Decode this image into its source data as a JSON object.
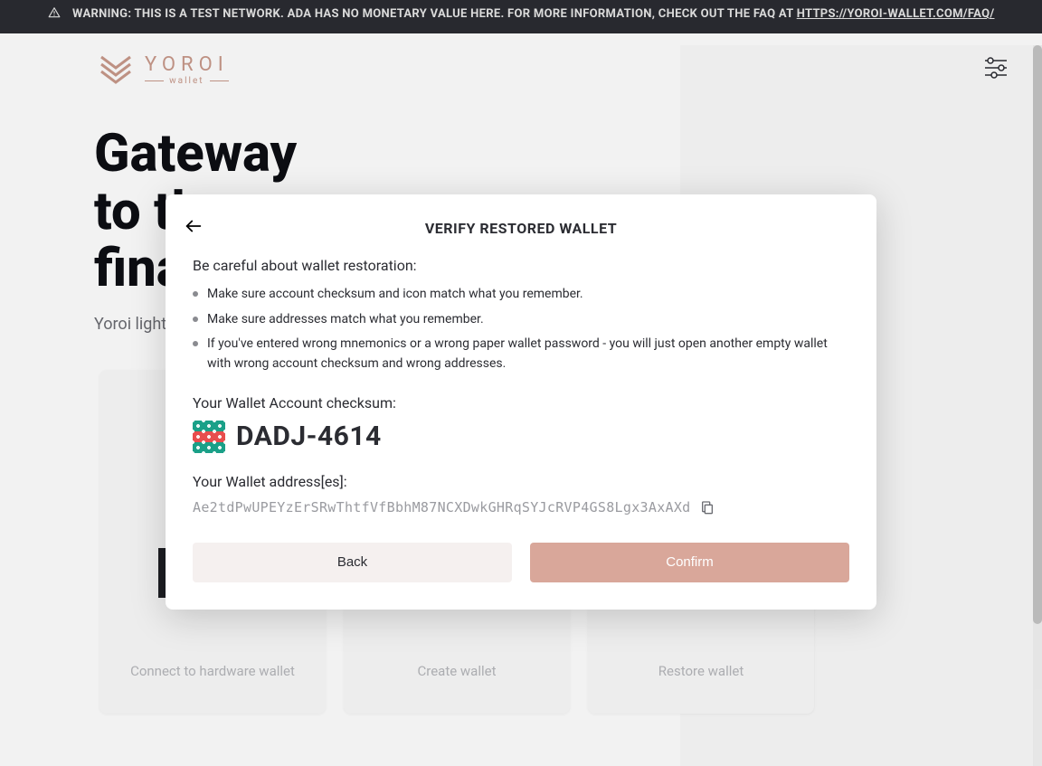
{
  "warning": {
    "text_pre": "WARNING: THIS IS A TEST NETWORK. ADA HAS NO MONETARY VALUE HERE. FOR MORE INFORMATION, CHECK OUT THE FAQ AT ",
    "link_text": "HTTPS://YOROI-WALLET.COM/FAQ/"
  },
  "brand": {
    "name": "YOROI",
    "sub": "wallet"
  },
  "hero": {
    "line1": "Gateway",
    "line2": "to the",
    "line3": "financial world",
    "tagline": "Yoroi light wallet for Cardano assets"
  },
  "cards": {
    "connect": "Connect to hardware wallet",
    "create": "Create wallet",
    "restore": "Restore wallet"
  },
  "modal": {
    "title": "VERIFY RESTORED WALLET",
    "intro": "Be careful about wallet restoration:",
    "bullets": [
      "Make sure account checksum and icon match what you remember.",
      "Make sure addresses match what you remember.",
      "If you've entered wrong mnemonics or a wrong paper wallet password - you will just open another empty wallet with wrong account checksum and wrong addresses."
    ],
    "checksum_label": "Your Wallet Account checksum:",
    "checksum_value": "DADJ-4614",
    "address_label": "Your Wallet address[es]:",
    "address_value": "Ae2tdPwUPEYzErSRwThtfVfBbhM87NCXDwkGHRqSYJcRVP4GS8Lgx3AxAXd",
    "back": "Back",
    "confirm": "Confirm"
  },
  "colors": {
    "accent": "#d9a79a"
  }
}
